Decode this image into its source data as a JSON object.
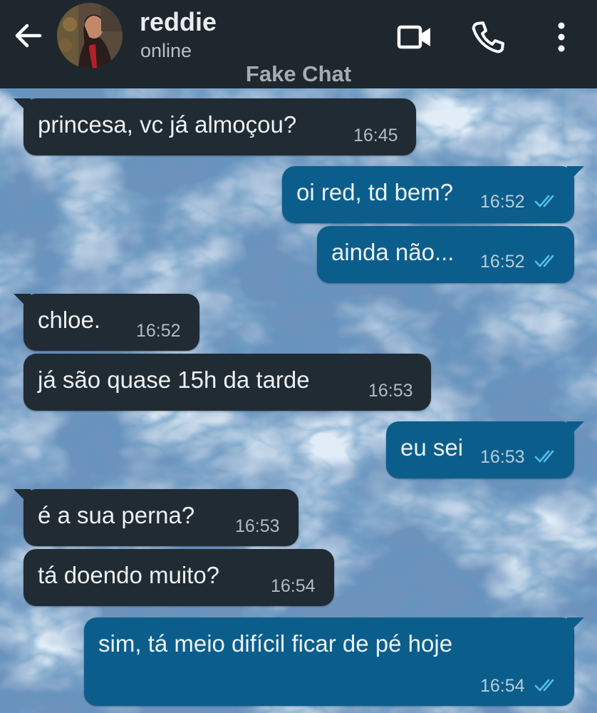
{
  "header": {
    "contact_name": "reddie",
    "contact_status": "online",
    "chat_label": "Fake Chat",
    "icons": {
      "back": "arrow-back-icon",
      "video": "video-call-icon",
      "phone": "voice-call-icon",
      "menu": "more-vert-icon"
    }
  },
  "colors": {
    "header_bg": "#1e272e",
    "incoming_bubble": "#212b33",
    "outgoing_bubble": "#0b5e8c",
    "read_ticks": "#53bdeb"
  },
  "messages": [
    {
      "dir": "in",
      "text": "princesa, vc já almoçou?",
      "time": "16:45"
    },
    {
      "dir": "out",
      "text": "oi red, td bem?",
      "time": "16:52"
    },
    {
      "dir": "out",
      "text": "ainda não...",
      "time": "16:52"
    },
    {
      "dir": "in",
      "text": "chloe.",
      "time": "16:52"
    },
    {
      "dir": "in",
      "text": "já são quase 15h da tarde",
      "time": "16:53"
    },
    {
      "dir": "out",
      "text": "eu sei",
      "time": "16:53"
    },
    {
      "dir": "in",
      "text": "é a sua perna?",
      "time": "16:53"
    },
    {
      "dir": "in",
      "text": "tá doendo muito?",
      "time": "16:54"
    },
    {
      "dir": "out",
      "text": "sim, tá meio difícil ficar de pé hoje",
      "time": "16:54"
    }
  ]
}
